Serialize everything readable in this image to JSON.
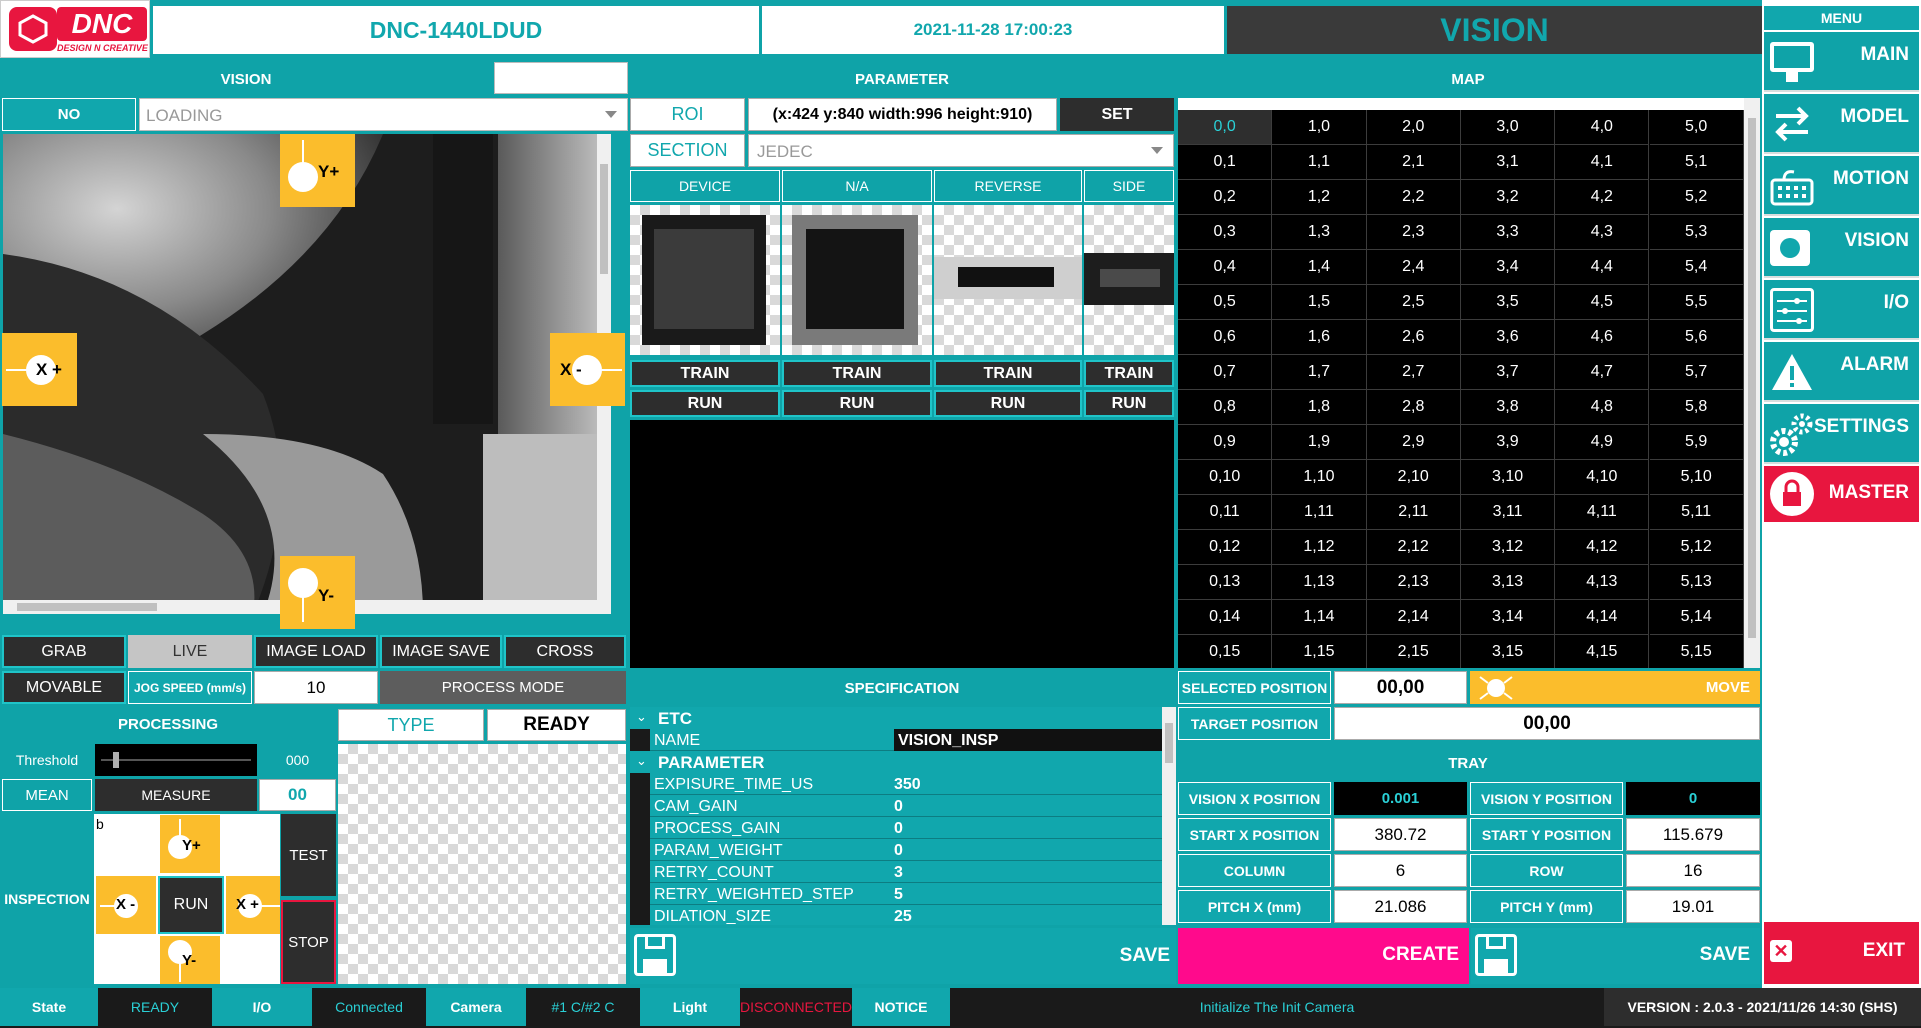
{
  "header": {
    "logo_text": "DNC",
    "logo_tagline": "DESIGN N CREATIVE",
    "machine_name": "DNC-1440LDUD",
    "datetime": "2021-11-28 17:00:23",
    "screen_title": "VISION"
  },
  "vision": {
    "title": "VISION",
    "no_label": "NO",
    "loading_value": "LOADING",
    "arrows": {
      "y_plus": "Y+",
      "y_minus": "Y-",
      "x_plus": "X +",
      "x_minus": "X -"
    },
    "buttons": {
      "grab": "GRAB",
      "live": "LIVE",
      "image_load": "IMAGE LOAD",
      "image_save": "IMAGE SAVE",
      "cross": "CROSS",
      "movable": "MOVABLE"
    },
    "jog_speed_label": "JOG SPEED (mm/s)",
    "jog_speed_value": "10",
    "process_mode": "PROCESS MODE"
  },
  "processing": {
    "title": "PROCESSING",
    "type_label": "TYPE",
    "type_value": "READY",
    "threshold_label": "Threshold",
    "threshold_value": "000",
    "threshold_fraction": 0.0,
    "mean_label": "MEAN",
    "measure_label": "MEASURE",
    "mean_value": "00",
    "inspection_label": "INSPECTION",
    "pad_text": "b",
    "y_plus": "Y+",
    "y_minus": "Y-",
    "x_minus": "X -",
    "x_plus": "X +",
    "run_label": "RUN",
    "test_label": "TEST",
    "stop_label": "STOP"
  },
  "parameter": {
    "title": "PARAMETER",
    "roi_label": "ROI",
    "roi_value": "(x:424 y:840 width:996 height:910)",
    "set_label": "SET",
    "section_label": "SECTION",
    "section_value": "JEDEC",
    "columns": [
      "DEVICE",
      "N/A",
      "REVERSE",
      "SIDE"
    ],
    "train_label": "TRAIN",
    "run_label": "RUN"
  },
  "specification": {
    "title": "SPECIFICATION",
    "groups": [
      {
        "name": "ETC",
        "rows": [
          {
            "key": "NAME",
            "value": "VISION_INSP"
          }
        ]
      },
      {
        "name": "PARAMETER",
        "rows": [
          {
            "key": "EXPISURE_TIME_US",
            "value": "350"
          },
          {
            "key": "CAM_GAIN",
            "value": "0"
          },
          {
            "key": "PROCESS_GAIN",
            "value": "0"
          },
          {
            "key": "PARAM_WEIGHT",
            "value": "0"
          },
          {
            "key": "RETRY_COUNT",
            "value": "3"
          },
          {
            "key": "RETRY_WEIGHTED_STEP",
            "value": "5"
          },
          {
            "key": "DILATION_SIZE",
            "value": "25"
          }
        ]
      }
    ],
    "save_label": "SAVE"
  },
  "map": {
    "title": "MAP",
    "cols": 6,
    "rows": 16,
    "selected_cell": "0,0",
    "selected_position_label": "SELECTED POSITION",
    "selected_position_value": "00,00",
    "move_label": "MOVE",
    "target_position_label": "TARGET POSITION",
    "target_position_value": "00,00"
  },
  "tray": {
    "title": "TRAY",
    "vision_x_label": "VISION X POSITION",
    "vision_x_value": "0.001",
    "vision_y_label": "VISION Y POSITION",
    "vision_y_value": "0",
    "start_x_label": "START X POSITION",
    "start_x_value": "380.72",
    "start_y_label": "START Y POSITION",
    "start_y_value": "115.679",
    "column_label": "COLUMN",
    "column_value": "6",
    "row_label": "ROW",
    "row_value": "16",
    "pitch_x_label": "PITCH X (mm)",
    "pitch_x_value": "21.086",
    "pitch_y_label": "PITCH Y (mm)",
    "pitch_y_value": "19.01",
    "create_label": "CREATE",
    "save_label": "SAVE"
  },
  "menu": {
    "title": "MENU",
    "items": [
      {
        "label": "MAIN",
        "icon": "monitor-icon"
      },
      {
        "label": "MODEL",
        "icon": "swap-arrows-icon"
      },
      {
        "label": "MOTION",
        "icon": "keypad-icon"
      },
      {
        "label": "VISION",
        "icon": "camera-lens-icon"
      },
      {
        "label": "I/O",
        "icon": "sliders-icon"
      },
      {
        "label": "ALARM",
        "icon": "warning-icon"
      },
      {
        "label": "SETTINGS",
        "icon": "gears-icon"
      },
      {
        "label": "MASTER",
        "icon": "lock-icon"
      }
    ],
    "exit_label": "EXIT"
  },
  "status_bar": {
    "state_label": "State",
    "state_value": "READY",
    "io_label": "I/O",
    "io_value": "Connected",
    "camera_label": "Camera",
    "camera_value": "#1 C/#2 C",
    "light_label": "Light",
    "light_value": "DISCONNECTED",
    "notice_label": "NOTICE",
    "notice_value": "Initialize The Init Camera",
    "version": "VERSION : 2.0.3 - 2021/11/26 14:30 (SHS)"
  },
  "colors": {
    "teal": "#11a7ad",
    "yellow": "#fbbd2c",
    "magenta": "#ff0a8c",
    "red": "#e8163f",
    "selected_cell_text": "#2ad0d6"
  }
}
